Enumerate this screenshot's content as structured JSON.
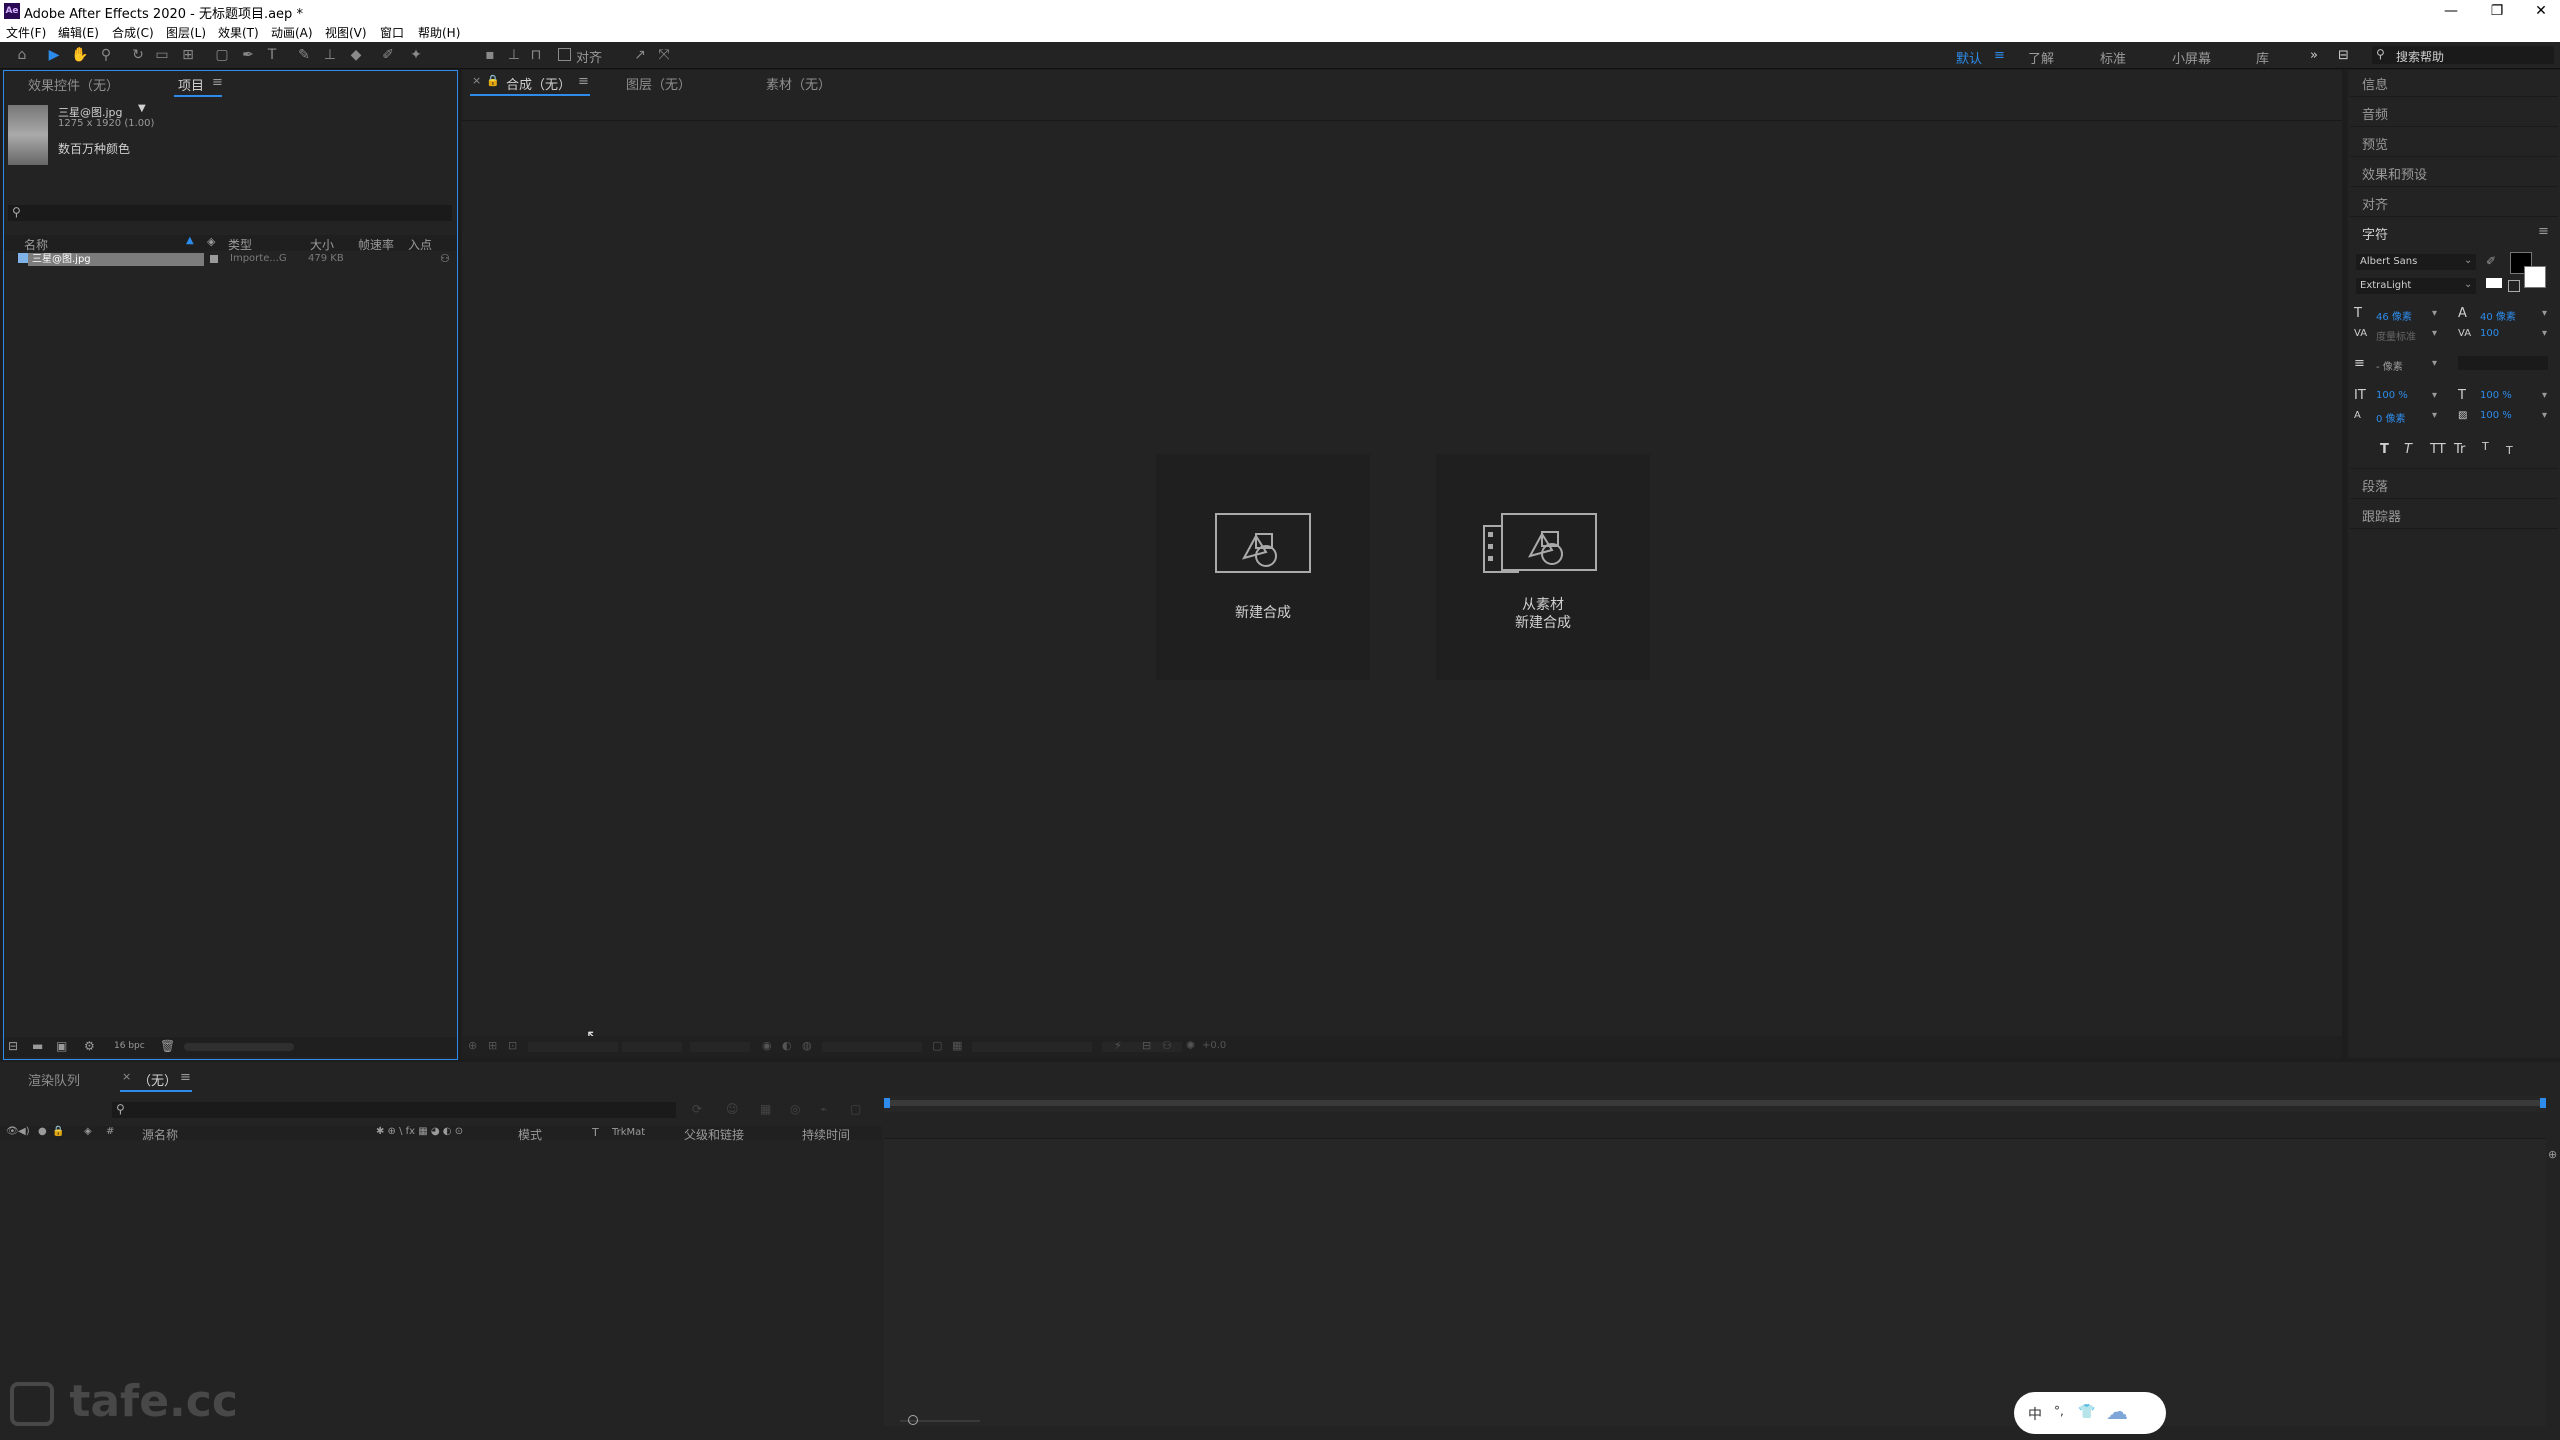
{
  "window": {
    "title": "Adobe After Effects 2020 - 无标题项目.aep *",
    "app_icon": "Ae",
    "controls": [
      "minimize-icon",
      "restore-icon",
      "close-icon"
    ]
  },
  "menu": [
    "文件(F)",
    "编辑(E)",
    "合成(C)",
    "图层(L)",
    "效果(T)",
    "动画(A)",
    "视图(V)",
    "窗口",
    "帮助(H)"
  ],
  "toolbar": {
    "align_label": "对齐",
    "workspaces": [
      {
        "label": "默认",
        "active": true
      },
      {
        "label": "了解",
        "active": false
      },
      {
        "label": "标准",
        "active": false
      },
      {
        "label": "小屏幕",
        "active": false
      },
      {
        "label": "库",
        "active": false
      }
    ],
    "search_placeholder": "搜索帮助"
  },
  "project_panel": {
    "tabs": [
      "效果控件（无）",
      "项目"
    ],
    "active_tab": "项目",
    "asset": {
      "name": "三星@图.jpg",
      "dimensions": "1275 x 1920 (1.00)",
      "colors": "数百万种颜色"
    },
    "columns": [
      "名称",
      "类型",
      "大小",
      "帧速率",
      "入点"
    ],
    "rows": [
      {
        "name": "三星@图.jpg",
        "type": "Importe...G",
        "size": "479 KB"
      }
    ],
    "footer_bpc": "16 bpc"
  },
  "viewer": {
    "tabs": [
      "合成（无）",
      "图层（无）",
      "素材（无）"
    ],
    "active_tab": "合成（无）",
    "cards": [
      {
        "label": "新建合成"
      },
      {
        "label_line1": "从素材",
        "label_line2": "新建合成"
      }
    ],
    "footer_value": "+0.0"
  },
  "right_panel": {
    "sections": [
      "信息",
      "音频",
      "预览",
      "效果和预设",
      "对齐"
    ],
    "character": {
      "title": "字符",
      "font": "Albert Sans",
      "style": "ExtraLight",
      "font_size": "46 像素",
      "leading": "40 像素",
      "kerning": "度量标准",
      "tracking": "100",
      "stroke": "- 像素",
      "vert_scale": "100 %",
      "horiz_scale": "100 %",
      "baseline": "0 像素",
      "tsume": "100 %",
      "style_buttons": [
        "T",
        "T",
        "TT",
        "Tr",
        "T",
        "T"
      ]
    },
    "bottom_sections": [
      "段落",
      "跟踪器"
    ]
  },
  "timeline": {
    "tabs": [
      "渲染队列",
      "（无）"
    ],
    "active_tab": "（无）",
    "columns": [
      "源名称",
      "模式",
      "T",
      "TrkMat",
      "父级和链接",
      "持续时间"
    ]
  },
  "watermark": "tafe.cc",
  "ime": {
    "mode": "中"
  },
  "colors": {
    "accent": "#2d8ceb",
    "panel_bg": "#232323",
    "app_bg": "#1d1d1d"
  }
}
